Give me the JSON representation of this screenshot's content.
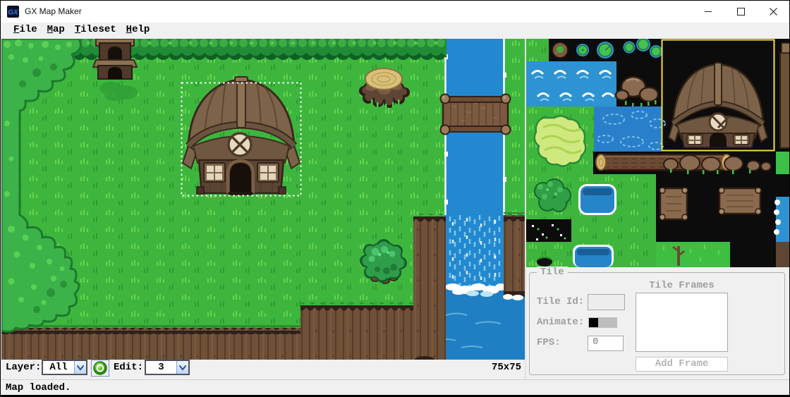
{
  "window": {
    "title": "GX Map Maker"
  },
  "menu": {
    "items": [
      {
        "label": "File"
      },
      {
        "label": "Map"
      },
      {
        "label": "Tileset"
      },
      {
        "label": "Help"
      }
    ]
  },
  "toolbar": {
    "layer_label": "Layer:",
    "layer_value": "All",
    "edit_label": "Edit:",
    "edit_value": "3",
    "map_size": "75x75"
  },
  "status": {
    "message": "Map loaded."
  },
  "tile_panel": {
    "group_title": "Tile",
    "tile_id_label": "Tile Id:",
    "tile_id_value": "",
    "animate_label": "Animate:",
    "fps_label": "FPS:",
    "fps_value": "0",
    "frames_label": "Tile Frames",
    "frames": [],
    "add_frame_label": "Add Frame"
  },
  "map": {
    "selected_object": "house",
    "selected_tile": "house"
  },
  "tileset_tiles": [
    "grass",
    "moss-rock",
    "lily-pad-small",
    "lily-pad-large",
    "lily-pad-cluster",
    "water-waves",
    "boulders",
    "flower-patch",
    "deep-water",
    "log",
    "bush",
    "pond",
    "sparkles",
    "pond-small",
    "house",
    "rocks-row",
    "sign-vertical",
    "sign-horizontal",
    "leaf-block",
    "sapling-grass"
  ],
  "colors": {
    "grass": "#3eb63e",
    "water": "#2288cf",
    "cliff": "#6f5138",
    "selection": "#ffffff",
    "tile_selection": "#f2de3c",
    "panel": "#f0f0f0"
  }
}
